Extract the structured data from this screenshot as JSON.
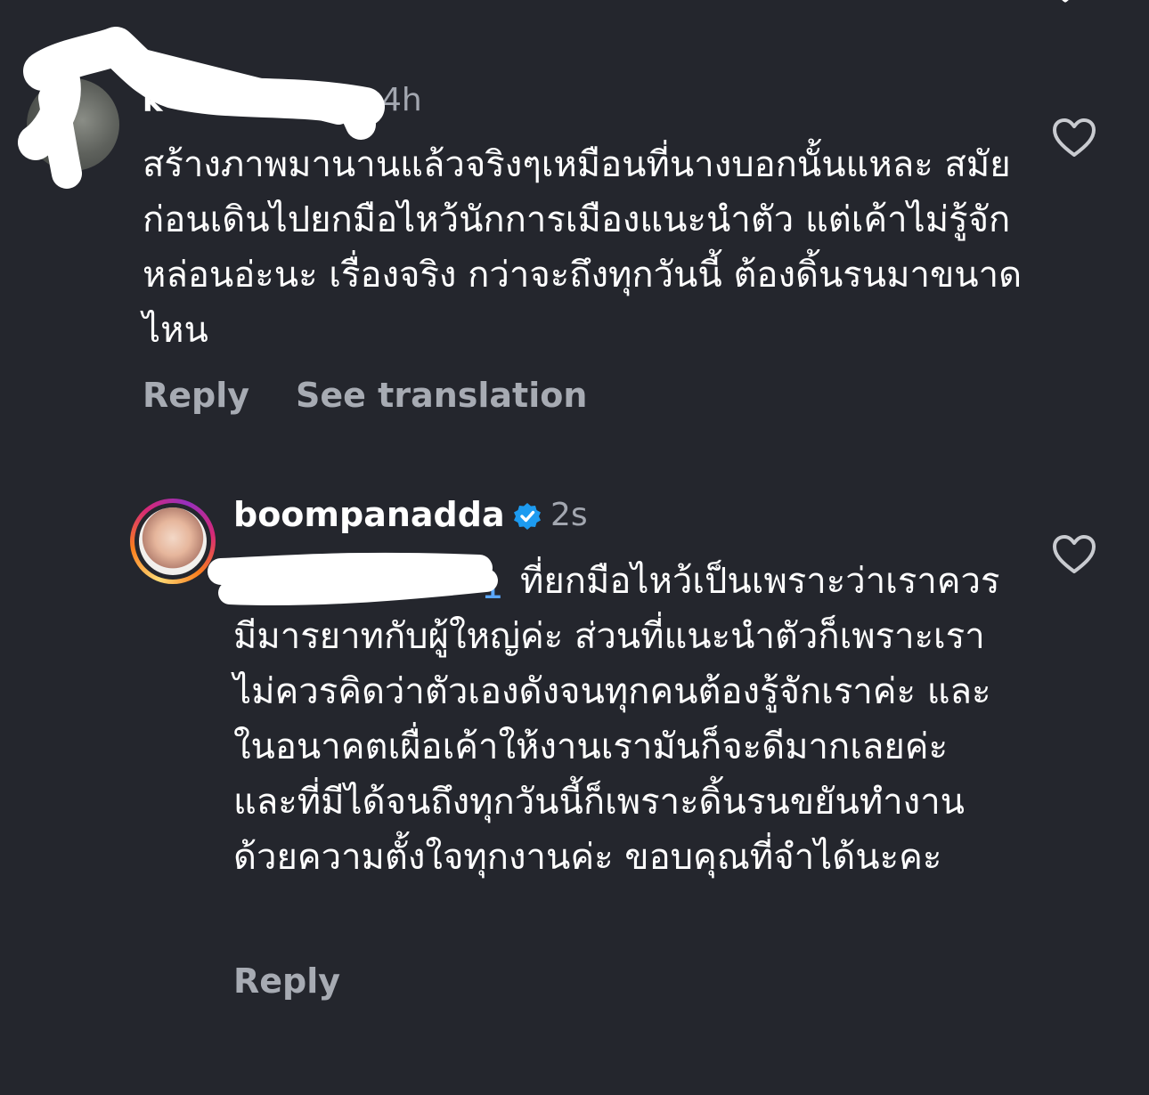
{
  "comments": [
    {
      "username": "k",
      "time": "4h",
      "body": "สร้างภาพมานานแล้วจริงๆเหมือนที่นางบอกนั้นแหละ สมัยก่อนเดินไปยกมือไหว้นักการเมืองแนะนำตัว แต่เค้าไม่รู้จักหล่อนอ่ะนะ เรื่องจริง กว่าจะถึงทุกวันนี้ ต้องดิ้นรนมาขนาดไหน",
      "reply_label": "Reply",
      "translate_label": "See translation",
      "like_icon": "heart-outline-icon"
    },
    {
      "username": "boompanadda",
      "verified_icon": "verified-badge-icon",
      "time": "2s",
      "mention_visible": "1",
      "body": "ที่ยกมือไหว้เป็นเพราะว่าเราควรมีมารยาทกับผู้ใหญ่ค่ะ ส่วนที่แนะนำตัวก็เพราะเราไม่ควรคิดว่าตัวเองดังจนทุกคนต้องรู้จักเราค่ะ และในอนาคตเผื่อเค้าให้งานเรามันก็จะดีมากเลยค่ะ และที่มีได้จนถึงทุกวันนี้ก็เพราะดิ้นรนขยันทำงานด้วยความตั้งใจทุกงานค่ะ ขอบคุณที่จำได้นะคะ",
      "reply_label": "Reply",
      "like_icon": "heart-outline-icon"
    }
  ],
  "colors": {
    "background": "#24262d",
    "secondary_text": "#a7abb3",
    "mention": "#5ba7ff",
    "verified": "#1d9bf0"
  }
}
